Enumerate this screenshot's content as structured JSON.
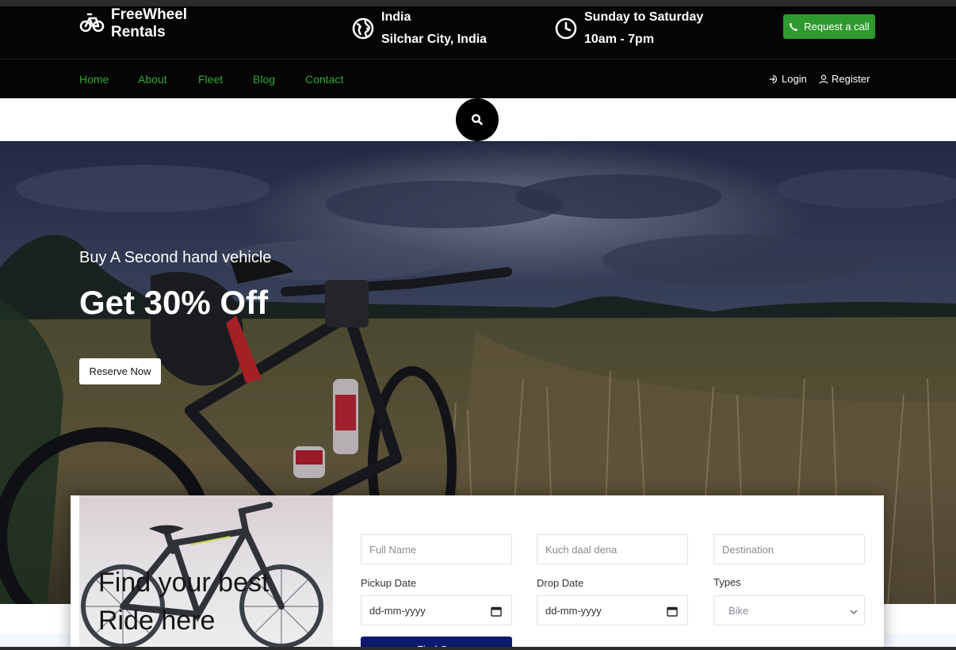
{
  "brand": {
    "line1": "FreeWheel",
    "line2": "Rentals",
    "icon": "bicycle-icon"
  },
  "location": {
    "icon": "globe-icon",
    "line1": "India",
    "line2": "Silchar City, India"
  },
  "hours": {
    "icon": "clock-icon",
    "line1": "Sunday to Saturday",
    "line2": "10am - 7pm"
  },
  "request_call": {
    "label": "Request a call",
    "icon": "phone-icon",
    "color": "#2e9a2e"
  },
  "nav": {
    "items": [
      {
        "label": "Home"
      },
      {
        "label": "About"
      },
      {
        "label": "Fleet"
      },
      {
        "label": "Blog"
      },
      {
        "label": "Contact"
      }
    ],
    "link_color": "#2eaa2e",
    "login": {
      "label": "Login",
      "icon": "login-icon"
    },
    "register": {
      "label": "Register",
      "icon": "user-icon"
    }
  },
  "search": {
    "icon": "search-icon"
  },
  "hero": {
    "subtitle": "Buy A Second hand vehicle",
    "title": "Get 30% Off",
    "button": "Reserve Now"
  },
  "booking": {
    "heading_line1": "Find your best",
    "heading_line2": "Ride here",
    "full_name_placeholder": "Full Name",
    "second_placeholder": "Kuch daal dena",
    "destination_placeholder": "Destination",
    "pickup_label": "Pickup Date",
    "drop_label": "Drop Date",
    "types_label": "Types",
    "pickup_value": "dd-mm-yyyy",
    "drop_value": "dd-mm-yyyy",
    "types_selected": "Bike",
    "find_button": "Find C..."
  }
}
